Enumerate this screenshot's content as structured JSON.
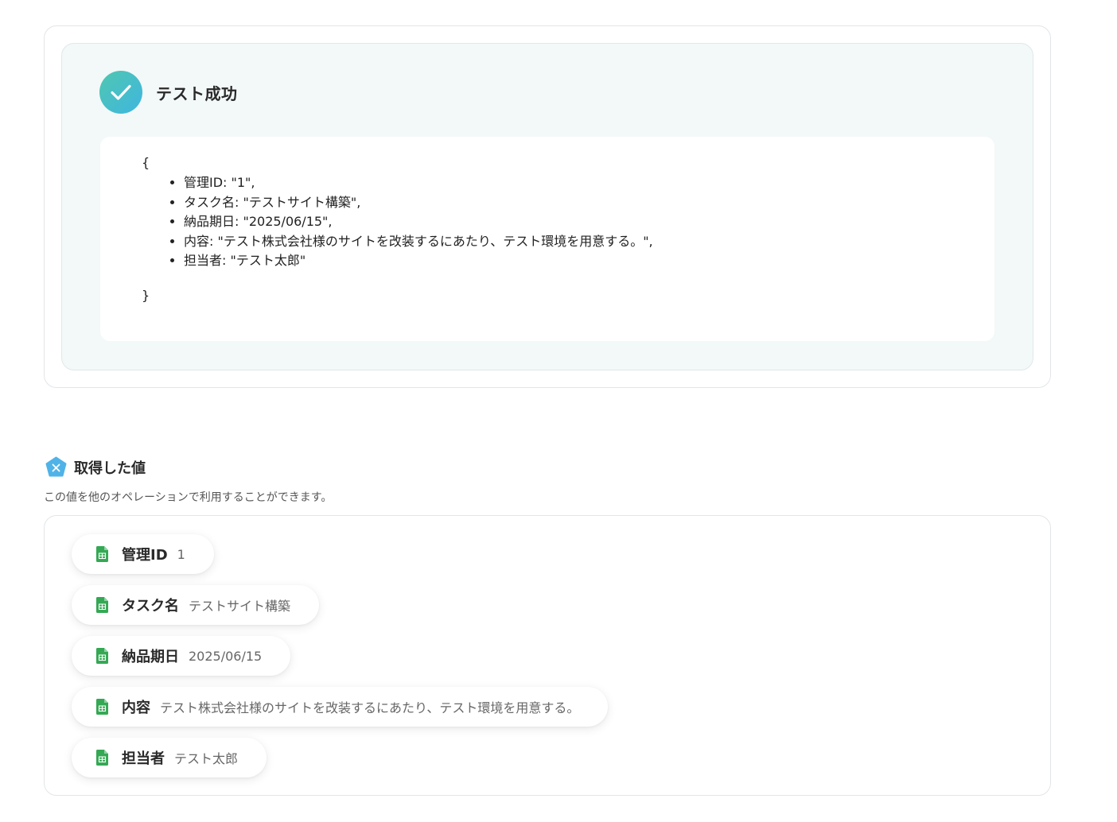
{
  "test_result": {
    "title": "テスト成功",
    "json_open": "{",
    "json_close": "}",
    "json_lines": [
      "管理ID: \"1\",",
      "タスク名: \"テストサイト構築\",",
      "納品期日: \"2025/06/15\",",
      "内容: \"テスト株式会社様のサイトを改装するにあたり、テスト環境を用意する。\",",
      "担当者: \"テスト太郎\""
    ]
  },
  "values_section": {
    "title": "取得した値",
    "description": "この値を他のオペレーションで利用することができます。",
    "items": [
      {
        "label": "管理ID",
        "value": "1"
      },
      {
        "label": "タスク名",
        "value": "テストサイト構築"
      },
      {
        "label": "納品期日",
        "value": "2025/06/15"
      },
      {
        "label": "内容",
        "value": "テスト株式会社様のサイトを改装するにあたり、テスト環境を用意する。"
      },
      {
        "label": "担当者",
        "value": "テスト太郎"
      }
    ]
  },
  "colors": {
    "success_gradient_start": "#4fc7b0",
    "success_gradient_end": "#3fb6e0",
    "sheets_green": "#34a853",
    "variable_icon_blue": "#4fb3e8",
    "panel_background": "#f3f8f8"
  },
  "icons": {
    "success": "check-circle-icon",
    "section": "variable-x-icon",
    "item": "google-sheets-icon"
  }
}
